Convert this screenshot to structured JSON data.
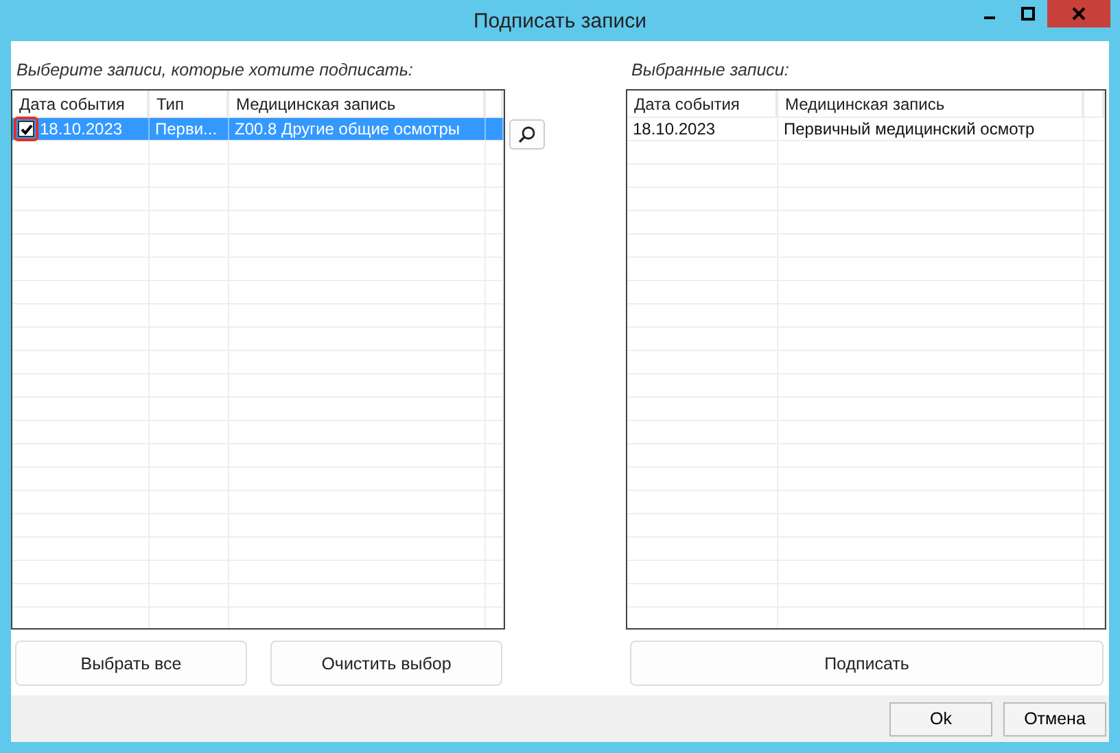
{
  "window": {
    "title": "Подписать записи"
  },
  "left": {
    "label": "Выберите записи, которые хотите подписать:",
    "columns": [
      "Дата события",
      "Тип",
      "Медицинская запись"
    ],
    "rows": [
      {
        "checked": true,
        "highlighted": true,
        "selected": true,
        "cells": [
          "18.10.2023",
          "Перви...",
          "Z00.8 Другие общие осмотры"
        ]
      }
    ],
    "buttons": [
      "Выбрать все",
      "Очистить выбор"
    ]
  },
  "right": {
    "label": "Выбранные записи:",
    "columns": [
      "Дата события",
      "Медицинская запись"
    ],
    "rows": [
      {
        "selected": false,
        "cells": [
          "18.10.2023",
          "Первичный медицинский осмотр"
        ]
      }
    ],
    "buttons": [
      "Подписать"
    ]
  },
  "footer_buttons": [
    "Ok",
    "Отмена"
  ]
}
